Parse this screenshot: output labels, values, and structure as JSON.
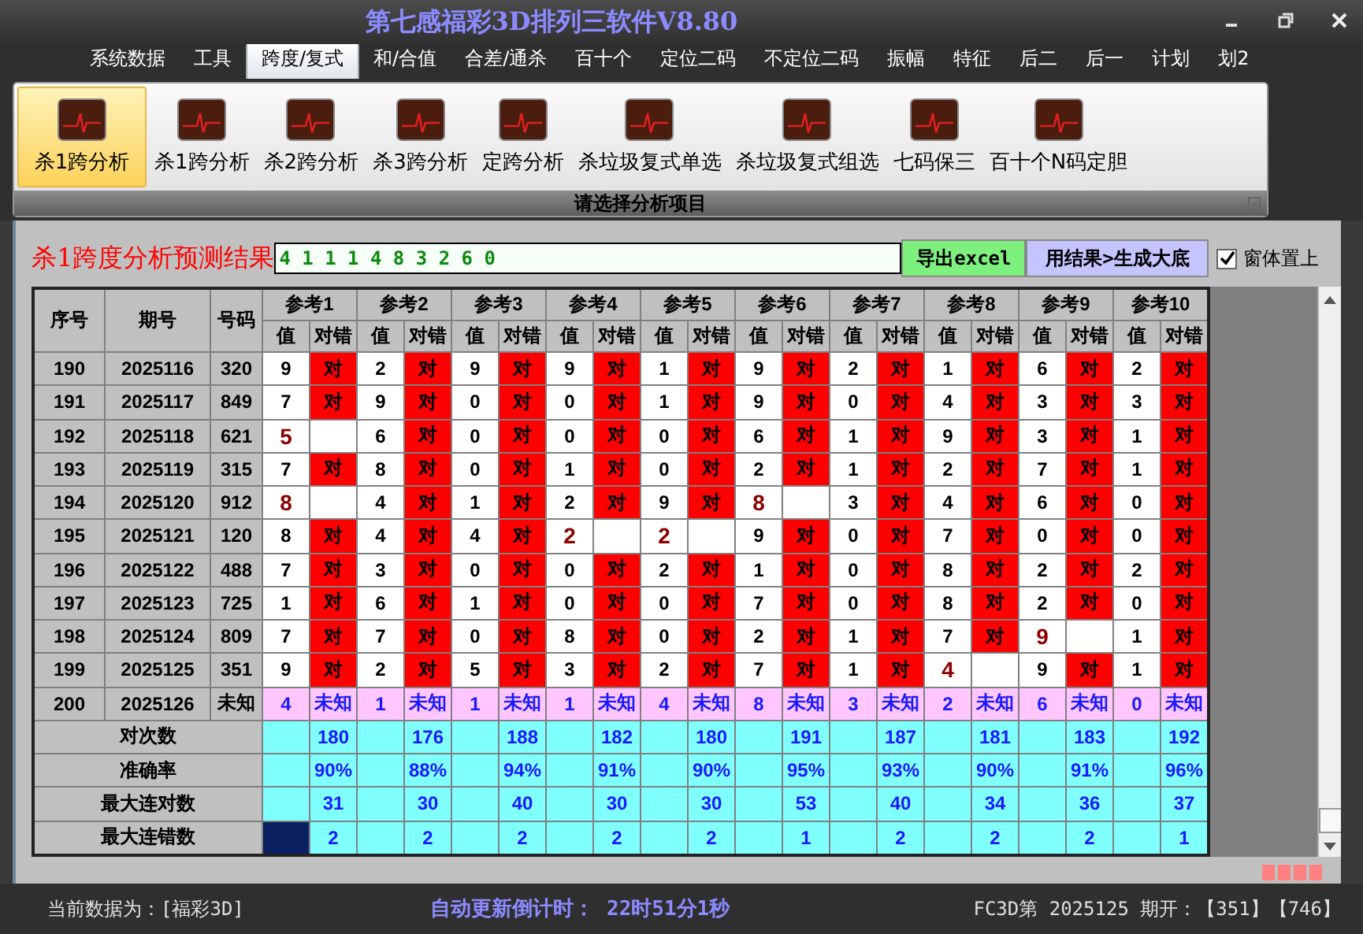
{
  "window": {
    "title": "第七感福彩3D排列三软件V8.80"
  },
  "menu_tabs": [
    {
      "label": "系统数据",
      "selected": false
    },
    {
      "label": "工具",
      "selected": false
    },
    {
      "label": "跨度/复式",
      "selected": true
    },
    {
      "label": "和/合值",
      "selected": false
    },
    {
      "label": "合差/通杀",
      "selected": false
    },
    {
      "label": "百十个",
      "selected": false
    },
    {
      "label": "定位二码",
      "selected": false
    },
    {
      "label": "不定位二码",
      "selected": false
    },
    {
      "label": "振幅",
      "selected": false
    },
    {
      "label": "特征",
      "selected": false
    },
    {
      "label": "后二",
      "selected": false
    },
    {
      "label": "后一",
      "selected": false
    },
    {
      "label": "计划",
      "selected": false
    },
    {
      "label": "划2",
      "selected": false
    }
  ],
  "ribbon": {
    "items": [
      {
        "label": "杀1跨分析",
        "selected": true
      },
      {
        "label": "杀1跨分析",
        "selected": false
      },
      {
        "label": "杀2跨分析",
        "selected": false
      },
      {
        "label": "杀3跨分析",
        "selected": false
      },
      {
        "label": "定跨分析",
        "selected": false
      },
      {
        "label": "杀垃圾复式单选",
        "selected": false
      },
      {
        "label": "杀垃圾复式组选",
        "selected": false
      },
      {
        "label": "七码保三",
        "selected": false
      },
      {
        "label": "百十个N码定胆",
        "selected": false
      }
    ],
    "group_label": "请选择分析项目"
  },
  "result": {
    "title": "杀1跨度分析预测结果",
    "value": "4 1 1 1 4 8 3 2 6 0"
  },
  "buttons": [
    {
      "label": "导出excel",
      "kind": "export"
    },
    {
      "label": "用结果>生成大底",
      "kind": "generate"
    }
  ],
  "stay_on_top": {
    "label": "窗体置上",
    "checked": true
  },
  "table": {
    "columns": [
      "序号",
      "期号",
      "号码"
    ],
    "ref_groups": [
      {
        "label": "参考1",
        "sub_columns": [
          "值",
          "对错"
        ]
      },
      {
        "label": "参考2",
        "sub_columns": [
          "值",
          "对错"
        ]
      },
      {
        "label": "参考3",
        "sub_columns": [
          "值",
          "对错"
        ]
      },
      {
        "label": "参考4",
        "sub_columns": [
          "值",
          "对错"
        ]
      },
      {
        "label": "参考5",
        "sub_columns": [
          "值",
          "对错"
        ]
      },
      {
        "label": "参考6",
        "sub_columns": [
          "值",
          "对错"
        ]
      },
      {
        "label": "参考7",
        "sub_columns": [
          "值",
          "对错"
        ]
      },
      {
        "label": "参考8",
        "sub_columns": [
          "值",
          "对错"
        ]
      },
      {
        "label": "参考9",
        "sub_columns": [
          "值",
          "对错"
        ]
      },
      {
        "label": "参考10",
        "sub_columns": [
          "值",
          "对错"
        ]
      }
    ],
    "rows": [
      {
        "kind": "history",
        "seq": "190",
        "issue": "2025116",
        "number": "320",
        "refs": [
          {
            "value": "9",
            "result": "对",
            "hit": true
          },
          {
            "value": "2",
            "result": "对",
            "hit": true
          },
          {
            "value": "9",
            "result": "对",
            "hit": true
          },
          {
            "value": "9",
            "result": "对",
            "hit": true
          },
          {
            "value": "1",
            "result": "对",
            "hit": true
          },
          {
            "value": "9",
            "result": "对",
            "hit": true
          },
          {
            "value": "2",
            "result": "对",
            "hit": true
          },
          {
            "value": "1",
            "result": "对",
            "hit": true
          },
          {
            "value": "6",
            "result": "对",
            "hit": true
          },
          {
            "value": "2",
            "result": "对",
            "hit": true
          }
        ]
      },
      {
        "kind": "history",
        "seq": "191",
        "issue": "2025117",
        "number": "849",
        "refs": [
          {
            "value": "7",
            "result": "对",
            "hit": true
          },
          {
            "value": "9",
            "result": "对",
            "hit": true
          },
          {
            "value": "0",
            "result": "对",
            "hit": true
          },
          {
            "value": "0",
            "result": "对",
            "hit": true
          },
          {
            "value": "1",
            "result": "对",
            "hit": true
          },
          {
            "value": "9",
            "result": "对",
            "hit": true
          },
          {
            "value": "0",
            "result": "对",
            "hit": true
          },
          {
            "value": "4",
            "result": "对",
            "hit": true
          },
          {
            "value": "3",
            "result": "对",
            "hit": true
          },
          {
            "value": "3",
            "result": "对",
            "hit": true
          }
        ]
      },
      {
        "kind": "history",
        "seq": "192",
        "issue": "2025118",
        "number": "621",
        "refs": [
          {
            "value": "5",
            "hit": false
          },
          {
            "value": "6",
            "result": "对",
            "hit": true
          },
          {
            "value": "0",
            "result": "对",
            "hit": true
          },
          {
            "value": "0",
            "result": "对",
            "hit": true
          },
          {
            "value": "0",
            "result": "对",
            "hit": true
          },
          {
            "value": "6",
            "result": "对",
            "hit": true
          },
          {
            "value": "1",
            "result": "对",
            "hit": true
          },
          {
            "value": "9",
            "result": "对",
            "hit": true
          },
          {
            "value": "3",
            "result": "对",
            "hit": true
          },
          {
            "value": "1",
            "result": "对",
            "hit": true
          }
        ]
      },
      {
        "kind": "history",
        "seq": "193",
        "issue": "2025119",
        "number": "315",
        "refs": [
          {
            "value": "7",
            "result": "对",
            "hit": true
          },
          {
            "value": "8",
            "result": "对",
            "hit": true
          },
          {
            "value": "0",
            "result": "对",
            "hit": true
          },
          {
            "value": "1",
            "result": "对",
            "hit": true
          },
          {
            "value": "0",
            "result": "对",
            "hit": true
          },
          {
            "value": "2",
            "result": "对",
            "hit": true
          },
          {
            "value": "1",
            "result": "对",
            "hit": true
          },
          {
            "value": "2",
            "result": "对",
            "hit": true
          },
          {
            "value": "7",
            "result": "对",
            "hit": true
          },
          {
            "value": "1",
            "result": "对",
            "hit": true
          }
        ]
      },
      {
        "kind": "history",
        "seq": "194",
        "issue": "2025120",
        "number": "912",
        "refs": [
          {
            "value": "8",
            "hit": false
          },
          {
            "value": "4",
            "result": "对",
            "hit": true
          },
          {
            "value": "1",
            "result": "对",
            "hit": true
          },
          {
            "value": "2",
            "result": "对",
            "hit": true
          },
          {
            "value": "9",
            "result": "对",
            "hit": true
          },
          {
            "value": "8",
            "hit": false
          },
          {
            "value": "3",
            "result": "对",
            "hit": true
          },
          {
            "value": "4",
            "result": "对",
            "hit": true
          },
          {
            "value": "6",
            "result": "对",
            "hit": true
          },
          {
            "value": "0",
            "result": "对",
            "hit": true
          }
        ]
      },
      {
        "kind": "history",
        "seq": "195",
        "issue": "2025121",
        "number": "120",
        "refs": [
          {
            "value": "8",
            "result": "对",
            "hit": true
          },
          {
            "value": "4",
            "result": "对",
            "hit": true
          },
          {
            "value": "4",
            "result": "对",
            "hit": true
          },
          {
            "value": "2",
            "hit": false
          },
          {
            "value": "2",
            "hit": false
          },
          {
            "value": "9",
            "result": "对",
            "hit": true
          },
          {
            "value": "0",
            "result": "对",
            "hit": true
          },
          {
            "value": "7",
            "result": "对",
            "hit": true
          },
          {
            "value": "0",
            "result": "对",
            "hit": true
          },
          {
            "value": "0",
            "result": "对",
            "hit": true
          }
        ]
      },
      {
        "kind": "history",
        "seq": "196",
        "issue": "2025122",
        "number": "488",
        "refs": [
          {
            "value": "7",
            "result": "对",
            "hit": true
          },
          {
            "value": "3",
            "result": "对",
            "hit": true
          },
          {
            "value": "0",
            "result": "对",
            "hit": true
          },
          {
            "value": "0",
            "result": "对",
            "hit": true
          },
          {
            "value": "2",
            "result": "对",
            "hit": true
          },
          {
            "value": "1",
            "result": "对",
            "hit": true
          },
          {
            "value": "0",
            "result": "对",
            "hit": true
          },
          {
            "value": "8",
            "result": "对",
            "hit": true
          },
          {
            "value": "2",
            "result": "对",
            "hit": true
          },
          {
            "value": "2",
            "result": "对",
            "hit": true
          }
        ]
      },
      {
        "kind": "history",
        "seq": "197",
        "issue": "2025123",
        "number": "725",
        "refs": [
          {
            "value": "1",
            "result": "对",
            "hit": true
          },
          {
            "value": "6",
            "result": "对",
            "hit": true
          },
          {
            "value": "1",
            "result": "对",
            "hit": true
          },
          {
            "value": "0",
            "result": "对",
            "hit": true
          },
          {
            "value": "0",
            "result": "对",
            "hit": true
          },
          {
            "value": "7",
            "result": "对",
            "hit": true
          },
          {
            "value": "0",
            "result": "对",
            "hit": true
          },
          {
            "value": "8",
            "result": "对",
            "hit": true
          },
          {
            "value": "2",
            "result": "对",
            "hit": true
          },
          {
            "value": "0",
            "result": "对",
            "hit": true
          }
        ]
      },
      {
        "kind": "history",
        "seq": "198",
        "issue": "2025124",
        "number": "809",
        "refs": [
          {
            "value": "7",
            "result": "对",
            "hit": true
          },
          {
            "value": "7",
            "result": "对",
            "hit": true
          },
          {
            "value": "0",
            "result": "对",
            "hit": true
          },
          {
            "value": "8",
            "result": "对",
            "hit": true
          },
          {
            "value": "0",
            "result": "对",
            "hit": true
          },
          {
            "value": "2",
            "result": "对",
            "hit": true
          },
          {
            "value": "1",
            "result": "对",
            "hit": true
          },
          {
            "value": "7",
            "result": "对",
            "hit": true
          },
          {
            "value": "9",
            "hit": false
          },
          {
            "value": "1",
            "result": "对",
            "hit": true
          }
        ]
      },
      {
        "kind": "history",
        "seq": "199",
        "issue": "2025125",
        "number": "351",
        "refs": [
          {
            "value": "9",
            "result": "对",
            "hit": true
          },
          {
            "value": "2",
            "result": "对",
            "hit": true
          },
          {
            "value": "5",
            "result": "对",
            "hit": true
          },
          {
            "value": "3",
            "result": "对",
            "hit": true
          },
          {
            "value": "2",
            "result": "对",
            "hit": true
          },
          {
            "value": "7",
            "result": "对",
            "hit": true
          },
          {
            "value": "1",
            "result": "对",
            "hit": true
          },
          {
            "value": "4",
            "hit": false
          },
          {
            "value": "9",
            "result": "对",
            "hit": true
          },
          {
            "value": "1",
            "result": "对",
            "hit": true
          }
        ]
      },
      {
        "kind": "pending",
        "seq": "200",
        "issue": "2025126",
        "number": "未知",
        "refs": [
          {
            "value": "4",
            "result": "未知"
          },
          {
            "value": "1",
            "result": "未知"
          },
          {
            "value": "1",
            "result": "未知"
          },
          {
            "value": "1",
            "result": "未知"
          },
          {
            "value": "4",
            "result": "未知"
          },
          {
            "value": "8",
            "result": "未知"
          },
          {
            "value": "3",
            "result": "未知"
          },
          {
            "value": "2",
            "result": "未知"
          },
          {
            "value": "6",
            "result": "未知"
          },
          {
            "value": "0",
            "result": "未知"
          }
        ]
      }
    ],
    "stats": [
      {
        "label": "对次数",
        "values": [
          "180",
          "176",
          "188",
          "182",
          "180",
          "191",
          "187",
          "181",
          "183",
          "192"
        ],
        "selected": false
      },
      {
        "label": "准确率",
        "values": [
          "90%",
          "88%",
          "94%",
          "91%",
          "90%",
          "95%",
          "93%",
          "90%",
          "91%",
          "96%"
        ],
        "selected": false
      },
      {
        "label": "最大连对数",
        "values": [
          "31",
          "30",
          "40",
          "30",
          "30",
          "53",
          "40",
          "34",
          "36",
          "37"
        ],
        "selected": false
      },
      {
        "label": "最大连错数",
        "values": [
          "2",
          "2",
          "2",
          "2",
          "2",
          "1",
          "2",
          "2",
          "2",
          "1"
        ],
        "selected": true
      }
    ]
  },
  "status_bar": {
    "data_source": "当前数据为：[福彩3D]",
    "countdown_label": "自动更新倒计时：",
    "countdown": "22时51分1秒",
    "draw_info": "FC3D第 2025125 期开：【351】【746】"
  }
}
